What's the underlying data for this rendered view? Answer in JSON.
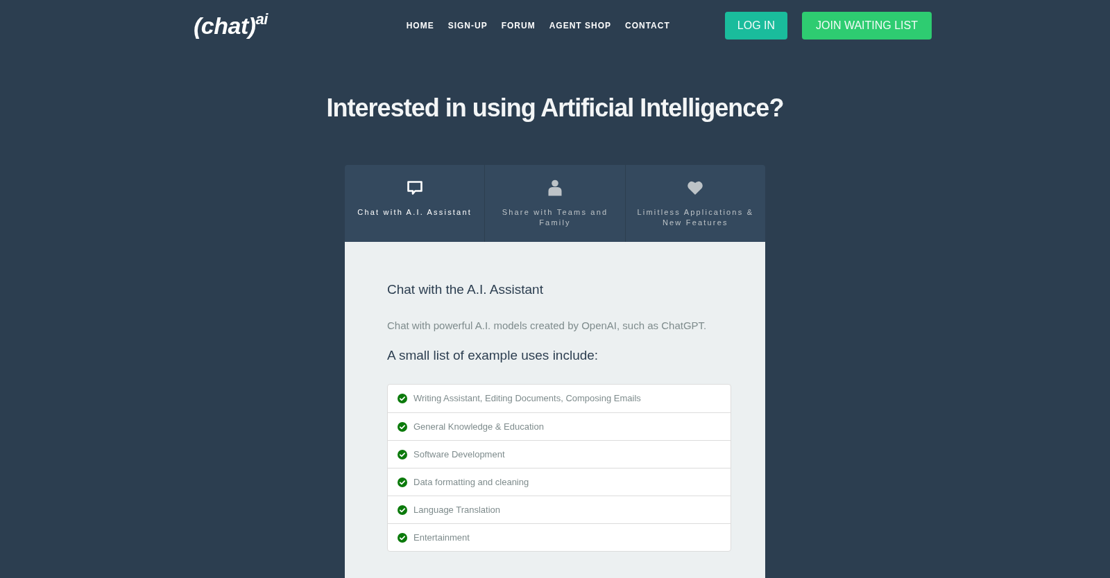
{
  "header": {
    "logo": "(chat)$^{ai}$",
    "nav": [
      "HOME",
      "SIGN-UP",
      "FORUM",
      "AGENT SHOP",
      "CONTACT"
    ],
    "buttons": [
      {
        "label": "LOG IN",
        "kind": "secondary"
      },
      {
        "label": "JOIN WAITING LIST",
        "kind": "primary"
      }
    ]
  },
  "hero": {
    "title": "Interested in using Artificial Intelligence?"
  },
  "feature_tabs": [
    {
      "label": "Chat with A.I. Assistant",
      "selected": true
    },
    {
      "label": "Share with Teams and Family",
      "selected": false
    },
    {
      "label": "Limitless Applications & New Features",
      "selected": false
    }
  ],
  "panel": {
    "title": "Chat with the A.I. Assistant",
    "description": "Chat with powerful A.I. models created by OpenAI, such as ChatGPT.",
    "list_heading": "A small list of example uses include:",
    "uses": [
      "Writing Assistant, Editing Documents, Composing Emails",
      "General Knowledge & Education",
      "Software Development",
      "Data formatting and cleaning",
      "Language Translation",
      "Entertainment"
    ]
  }
}
